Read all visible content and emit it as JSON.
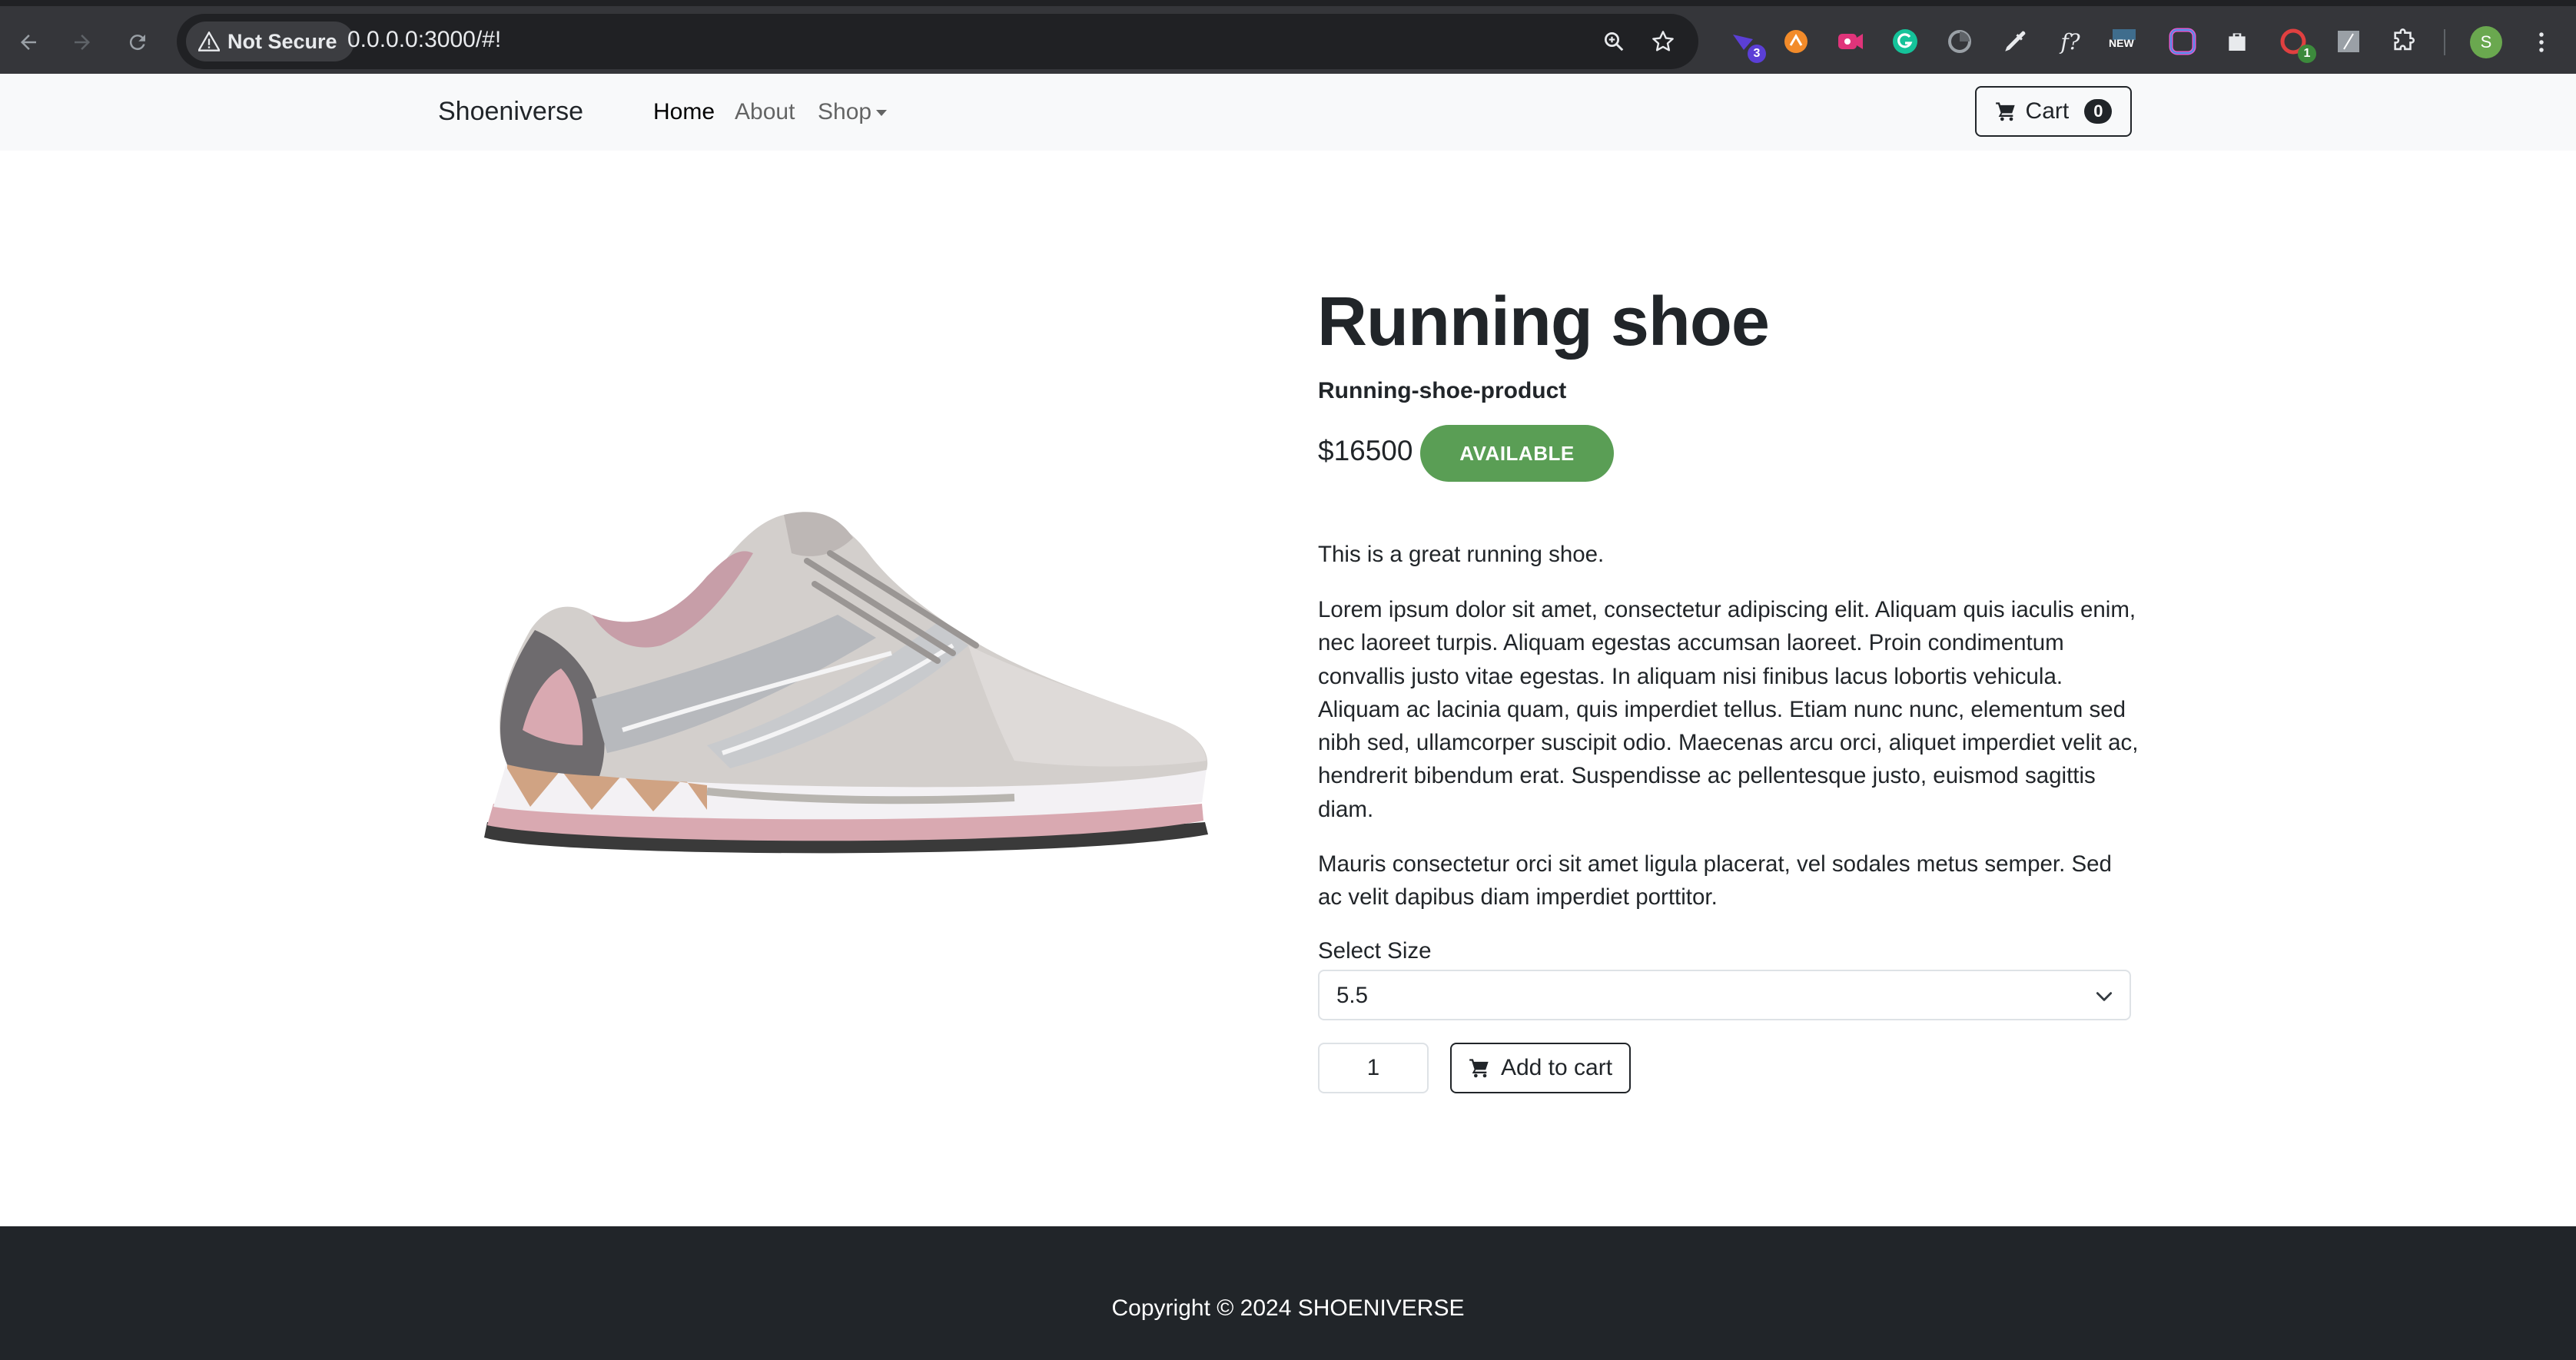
{
  "browser": {
    "security_label": "Not Secure",
    "url": "0.0.0.0:3000/#!",
    "extensions": [
      {
        "name": "ext-1-icon",
        "badge": "3",
        "color": "#5b3fd6"
      },
      {
        "name": "ext-2-icon",
        "badge": "",
        "color": "#f28b2a"
      },
      {
        "name": "ext-3-icon",
        "badge": "",
        "color": "#e0347a"
      },
      {
        "name": "grammarly-icon",
        "badge": "",
        "color": "#15c39a"
      },
      {
        "name": "ext-5-icon",
        "badge": "",
        "color": "#9aa0a6"
      },
      {
        "name": "eyedropper-icon",
        "badge": "",
        "color": "#e8eaed"
      },
      {
        "name": "function-icon",
        "badge": "",
        "color": "#e8eaed"
      },
      {
        "name": "ext-new-icon",
        "badge": "",
        "color": "#4aa3df"
      },
      {
        "name": "ext-9-icon",
        "badge": "",
        "color": "#e05bd0"
      },
      {
        "name": "ext-10-icon",
        "badge": "",
        "color": "#e8eaed"
      },
      {
        "name": "ext-11-icon",
        "badge": "1",
        "color": "#e04040"
      },
      {
        "name": "ext-12-icon",
        "badge": "",
        "color": "#9aa0a6"
      },
      {
        "name": "extensions-puzzle-icon",
        "badge": "",
        "color": "#e8eaed"
      }
    ],
    "ext_new_label": "NEW",
    "function_label": "f?",
    "profile_initial": "S"
  },
  "navbar": {
    "brand": "Shoeniverse",
    "links": [
      {
        "label": "Home",
        "active": true
      },
      {
        "label": "About",
        "active": false
      },
      {
        "label": "Shop",
        "active": false
      }
    ],
    "cart_label": "Cart",
    "cart_count": "0"
  },
  "product": {
    "title": "Running shoe",
    "subtitle": "Running-shoe-product",
    "price": "$16500",
    "availability": "AVAILABLE",
    "description": [
      "This is a great running shoe.",
      "Lorem ipsum dolor sit amet, consectetur adipiscing elit. Aliquam quis iaculis enim, nec laoreet turpis. Aliquam egestas accumsan laoreet. Proin condimentum convallis justo vitae egestas. In aliquam nisi finibus lacus lobortis vehicula. Aliquam ac lacinia quam, quis imperdiet tellus. Etiam nunc nunc, elementum sed nibh sed, ullamcorper suscipit odio. Maecenas arcu orci, aliquet imperdiet velit ac, hendrerit bibendum erat. Suspendisse ac pellentesque justo, euismod sagittis diam.",
      "Mauris consectetur orci sit amet ligula placerat, vel sodales metus semper. Sed ac velit dapibus diam imperdiet porttitor."
    ],
    "size_label": "Select Size",
    "size_value": "5.5",
    "quantity": "1",
    "add_to_cart_label": "Add to cart"
  },
  "footer": {
    "copyright": "Copyright © 2024 SHOENIVERSE"
  },
  "colors": {
    "available_badge": "#5a9e55",
    "footer_bg": "#212529",
    "navbar_bg": "#f8f9fa"
  }
}
